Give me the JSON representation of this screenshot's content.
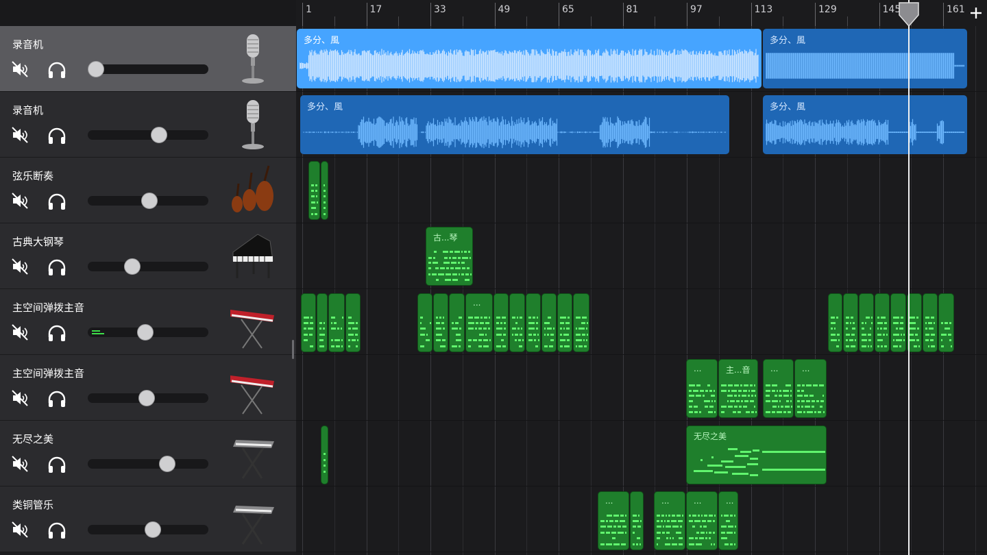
{
  "ruler": {
    "labels": [
      "1",
      "17",
      "33",
      "49",
      "65",
      "81",
      "97",
      "113",
      "129",
      "145",
      "161"
    ]
  },
  "add_track_icon": "plus-icon",
  "tracks": [
    {
      "name": "录音机",
      "instrument": "microphone-icon",
      "volume": 0.07,
      "selected": true
    },
    {
      "name": "录音机",
      "instrument": "microphone-icon",
      "volume": 0.59,
      "selected": false
    },
    {
      "name": "弦乐断奏",
      "instrument": "strings-icon",
      "volume": 0.51,
      "selected": false
    },
    {
      "name": "古典大钢琴",
      "instrument": "grand-piano-icon",
      "volume": 0.37,
      "selected": false
    },
    {
      "name": "主空间弹拨主音",
      "instrument": "synth-keyboard-icon",
      "volume": 0.48,
      "selected": false
    },
    {
      "name": "主空间弹拨主音",
      "instrument": "synth-keyboard-icon",
      "volume": 0.49,
      "selected": false
    },
    {
      "name": "无尽之美",
      "instrument": "keyboard-stand-icon",
      "volume": 0.66,
      "selected": false
    },
    {
      "name": "类铜管乐",
      "instrument": "keyboard-stand-icon",
      "volume": 0.54,
      "selected": false
    }
  ],
  "regions": {
    "audio_name": "多分、風",
    "piano_name": "古...琴",
    "lead_name": "主...音",
    "ellipsis": "...",
    "pad_name": "无尽之美"
  },
  "colors": {
    "audio": "#1f67b5",
    "audio_selected": "#46a4ff",
    "midi": "#1f7f2c",
    "midi_note": "#61f56e",
    "selected_track": "#5a5a5e"
  }
}
